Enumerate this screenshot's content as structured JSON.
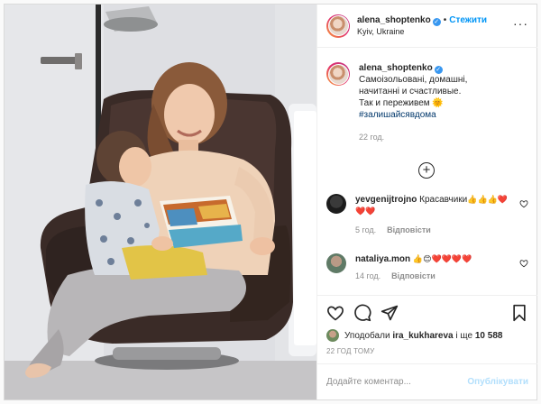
{
  "header": {
    "username": "alena_shoptenko",
    "follow_label": "Стежити",
    "location": "Kyiv, Ukraine"
  },
  "caption": {
    "username": "alena_shoptenko",
    "lines": [
      "Самоізольовані, домашні,",
      "начитанні и счастливые.",
      "Так и переживем"
    ],
    "emoji": "🌞",
    "hashtag": "#залишайсявдома",
    "time": "22 год."
  },
  "comments": [
    {
      "username": "yevgenijtrojno",
      "text": "Красавчики",
      "emoji_tail": "👍👍👍❤️❤️❤️",
      "time": "5 год.",
      "reply": "Відповісти"
    },
    {
      "username": "nataliya.mon",
      "text": "",
      "emoji_tail": "👍😊❤️❤️❤️❤️",
      "time": "14 год.",
      "reply": "Відповісти"
    }
  ],
  "likes": {
    "prefix": "Уподобали",
    "user": "ira_kukhareva",
    "suffix": "і ще",
    "count": "10 588"
  },
  "posted": "22 ГОД ТОМУ",
  "add_comment": {
    "placeholder": "Додайте коментар...",
    "publish_label": "Опублікувати"
  },
  "colors": {
    "accent": "#0095f6",
    "verified": "#3897f0",
    "heart": "#ed4956",
    "publish_disabled": "#b2dffc"
  },
  "icons": [
    "more-icon",
    "verified-icon",
    "add-circle-icon",
    "heart-icon",
    "comment-icon",
    "share-icon",
    "bookmark-icon"
  ]
}
